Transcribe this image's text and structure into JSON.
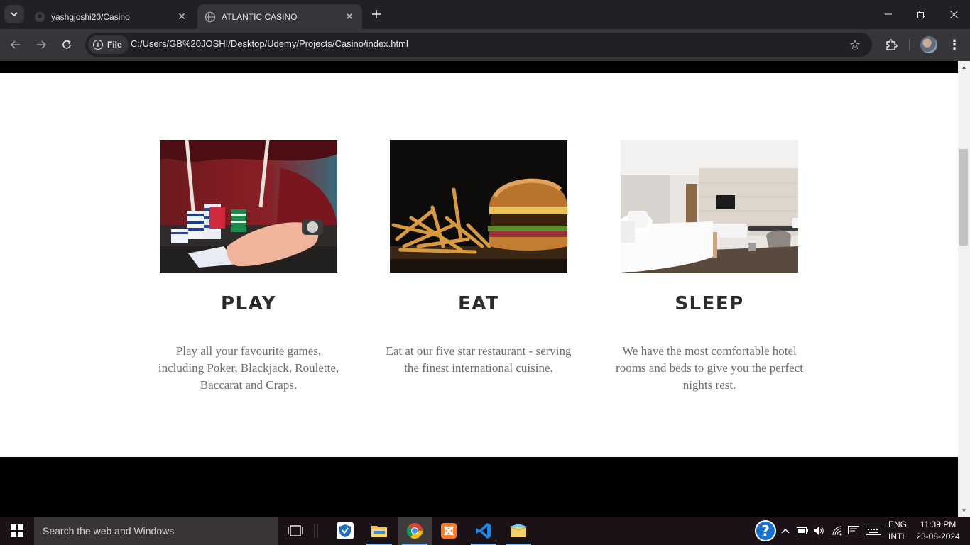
{
  "browser": {
    "tabs": [
      {
        "title": "yashgjoshi20/Casino",
        "active": false
      },
      {
        "title": "ATLANTIC CASINO",
        "active": true
      }
    ],
    "site_chip_label": "File",
    "url": "C:/Users/GB%20JOSHI/Desktop/Udemy/Projects/Casino/index.html"
  },
  "page": {
    "features": [
      {
        "title": "PLAY",
        "text": "Play all your favourite games, including Poker, Blackjack, Roulette, Baccarat and Craps.",
        "image": "casino-chips-photo"
      },
      {
        "title": "EAT",
        "text": "Eat at our five star restaurant - serving the finest international cuisine.",
        "image": "burger-fries-photo"
      },
      {
        "title": "SLEEP",
        "text": "We have the most comfortable hotel rooms and beds to give you the perfect nights rest.",
        "image": "hotel-room-photo"
      }
    ]
  },
  "taskbar": {
    "search_placeholder": "Search the web and Windows",
    "language_line1": "ENG",
    "language_line2": "INTL",
    "time": "11:39 PM",
    "date": "23-08-2024"
  },
  "colors": {
    "chrome_dark": "#202124",
    "chrome_toolbar": "#35363a",
    "page_band": "#000000",
    "feature_title": "#2c2c2c",
    "feature_text": "#6b6b6b"
  }
}
